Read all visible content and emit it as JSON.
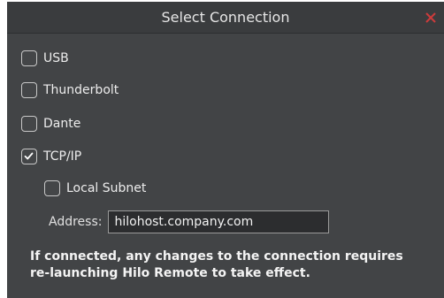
{
  "dialog": {
    "title": "Select Connection",
    "close_color": "#cc3b3b"
  },
  "options": {
    "usb": {
      "label": "USB",
      "checked": false
    },
    "thunderbolt": {
      "label": "Thunderbolt",
      "checked": false
    },
    "dante": {
      "label": "Dante",
      "checked": false
    },
    "tcpip": {
      "label": "TCP/IP",
      "checked": true
    },
    "local_subnet": {
      "label": "Local Subnet",
      "checked": false
    }
  },
  "address": {
    "label": "Address:",
    "value": "hilohost.company.com"
  },
  "note": {
    "line1": "If connected, any changes to the connection requires",
    "line2": "re-launching Hilo Remote to take effect."
  }
}
